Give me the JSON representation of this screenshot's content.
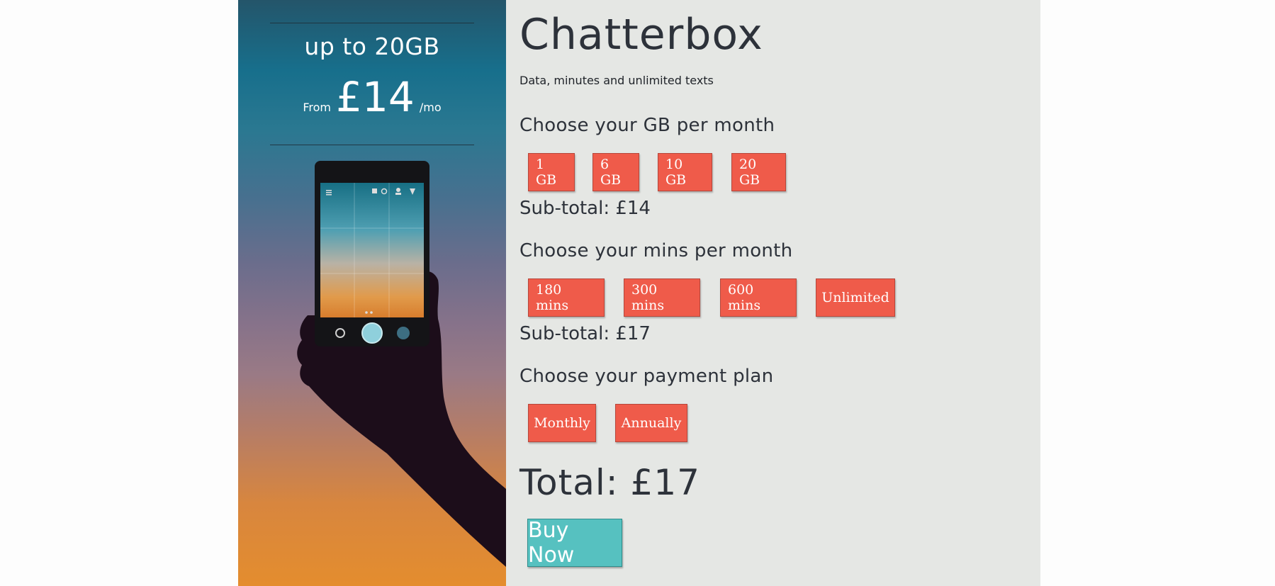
{
  "promo": {
    "headline": "up to 20GB",
    "price_prefix": "From",
    "price_amount": "£14",
    "price_suffix": "/mo"
  },
  "plan": {
    "title": "Chatterbox",
    "subtitle": "Data, minutes and unlimited texts"
  },
  "data_section": {
    "label": "Choose your GB per month",
    "options": [
      "1 GB",
      "6 GB",
      "10 GB",
      "20 GB"
    ],
    "subtotal": "Sub-total: £14"
  },
  "mins_section": {
    "label": "Choose your mins per month",
    "options": [
      "180 mins",
      "300 mins",
      "600 mins",
      "Unlimited"
    ],
    "subtotal": "Sub-total: £17"
  },
  "payment_section": {
    "label": "Choose your payment plan",
    "options": [
      "Monthly",
      "Annually"
    ]
  },
  "total": "Total: £17",
  "buy_label": "Buy Now",
  "colors": {
    "option_button": "#ef5b4a",
    "buy_button": "#56c1c0",
    "panel_background": "#e5e7e4"
  }
}
